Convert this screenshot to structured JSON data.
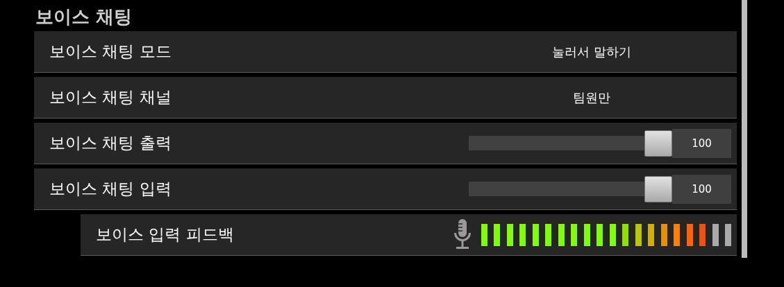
{
  "section": {
    "title": "보이스 채팅"
  },
  "settings": [
    {
      "kind": "value",
      "label": "보이스 채팅 모드",
      "value": "눌러서 말하기"
    },
    {
      "kind": "value",
      "label": "보이스 채팅 채널",
      "value": "팀원만"
    },
    {
      "kind": "slider",
      "label": "보이스 채팅 출력",
      "level": 1,
      "reading": "100"
    },
    {
      "kind": "slider",
      "label": "보이스 채팅 입력",
      "level": 1,
      "reading": "100",
      "children": [
        {
          "kind": "meter",
          "label": "보이스 입력 피드백",
          "level": 0.9
        }
      ]
    }
  ]
}
